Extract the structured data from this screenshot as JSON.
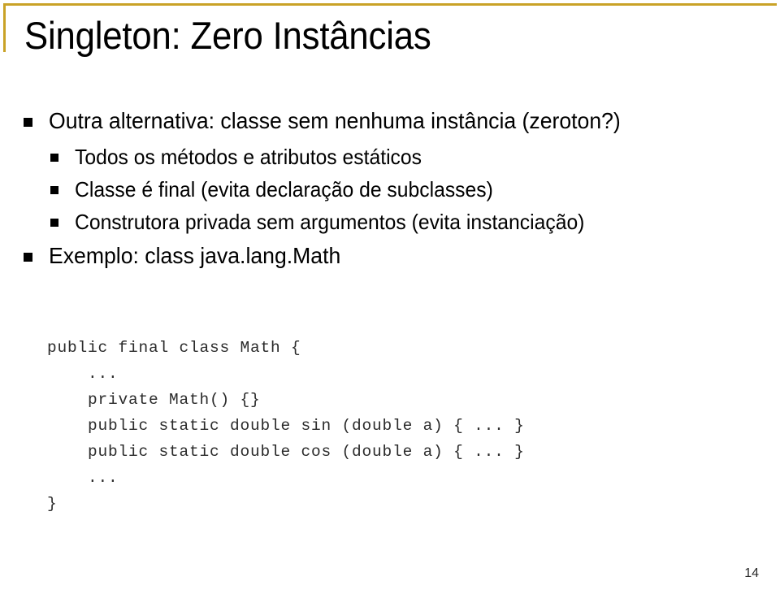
{
  "slide": {
    "title": "Singleton: Zero Instâncias",
    "number": "14",
    "accent_color": "#C9A227",
    "text_color": "#000000",
    "background_color": "#FFFFFF",
    "bullets": [
      {
        "level": 1,
        "text": "Outra alternativa: classe sem nenhuma instância (zeroton?)"
      },
      {
        "level": 2,
        "text": "Todos os métodos e atributos estáticos"
      },
      {
        "level": 2,
        "text": "Classe é final (evita declaração de subclasses)"
      },
      {
        "level": 2,
        "text": "Construtora privada sem argumentos (evita instanciação)"
      },
      {
        "level": 1,
        "text": "Exemplo: class java.lang.Math"
      }
    ],
    "code": "public final class Math {\n    ...\n    private Math() {}\n    public static double sin (double a) { ... }\n    public static double cos (double a) { ... }\n    ...\n}"
  }
}
